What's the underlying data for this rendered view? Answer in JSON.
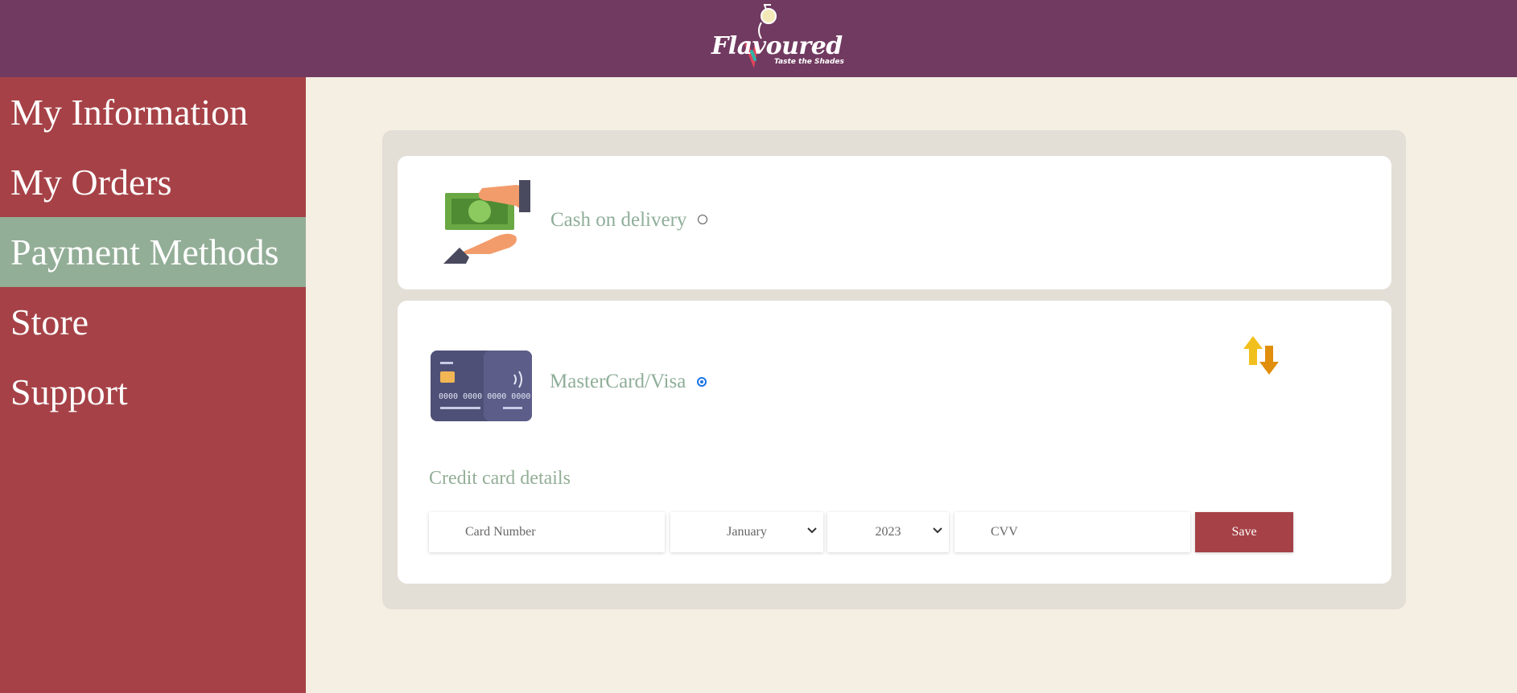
{
  "header": {
    "logo_text": "Flavoured",
    "logo_tagline": "Taste the Shades",
    "background": "#713a60"
  },
  "sidebar": {
    "background": "#a64247",
    "active_color": "#93ae97",
    "items": [
      {
        "label": "My Information",
        "active": false
      },
      {
        "label": "My Orders",
        "active": false
      },
      {
        "label": "Payment Methods",
        "active": true
      },
      {
        "label": "Store",
        "active": false
      },
      {
        "label": "Support",
        "active": false
      }
    ]
  },
  "payment_methods": [
    {
      "label": "Cash on delivery",
      "icon": "cash-hand-icon",
      "selected": false
    },
    {
      "label": "MasterCard/Visa",
      "icon": "credit-card-icon",
      "selected": true
    }
  ],
  "credit_card": {
    "title": "Credit card details",
    "card_number_placeholder": "Card Number",
    "month_value": "January",
    "year_value": "2023",
    "cvv_placeholder": "CVV",
    "save_label": "Save",
    "save_color": "#a64247"
  },
  "icons": {
    "sort_icon": "swap-arrows-icon"
  }
}
